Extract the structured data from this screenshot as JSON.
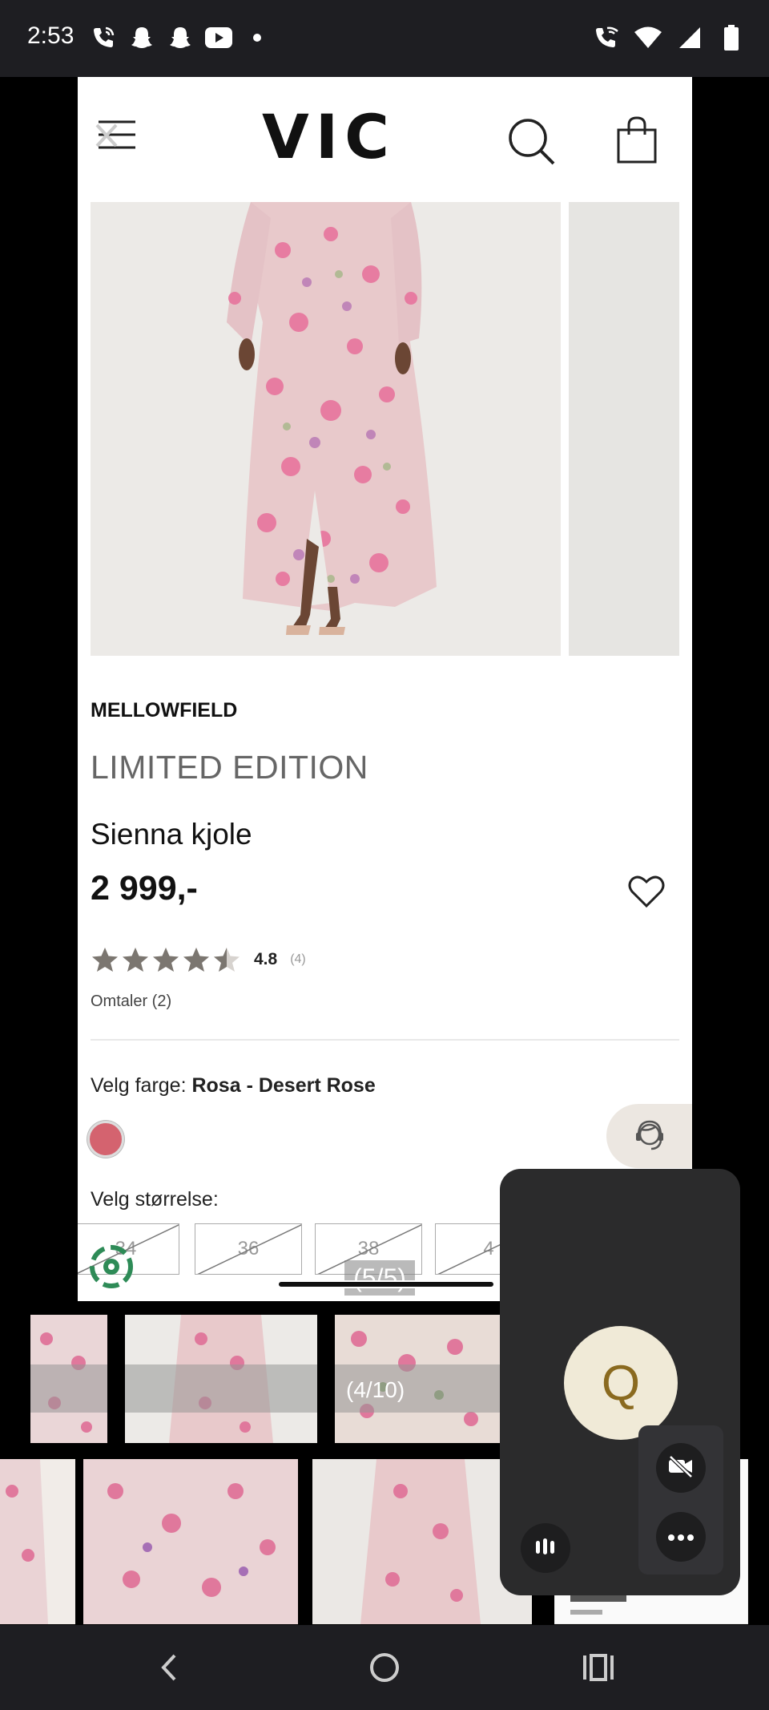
{
  "status_bar": {
    "time": "2:53",
    "left_icons": [
      "phone-wifi-icon",
      "snapchat-icon",
      "snapchat-icon",
      "youtube-icon",
      "dot-icon"
    ],
    "right_icons": [
      "wifi-calling-icon",
      "wifi-icon",
      "signal-icon",
      "battery-icon"
    ]
  },
  "webpage": {
    "logo": "VIC",
    "brand": "MELLOWFIELD",
    "edition": "LIMITED EDITION",
    "product_name": "Sienna kjole",
    "price": "2 999,-",
    "rating": {
      "value": "4.8",
      "count": "(4)",
      "stars": 4.5
    },
    "reviews_link": "Omtaler (2)",
    "color_label": "Velg farge: ",
    "color_value": "Rosa - Desert Rose",
    "swatch_color": "#d4636f",
    "size_label": "Velg størrelse:",
    "sizes": [
      "34",
      "36",
      "38",
      "4"
    ],
    "image_pager": "(5/5)"
  },
  "thumb_strip": {
    "pager": "(4/10)"
  },
  "overlay": {
    "avatar_letter": "Q",
    "icons": [
      "audio-bars-icon",
      "video-off-icon",
      "more-options-icon"
    ]
  },
  "nav_bar": {
    "icons": [
      "back-icon",
      "home-icon",
      "recents-icon"
    ]
  }
}
